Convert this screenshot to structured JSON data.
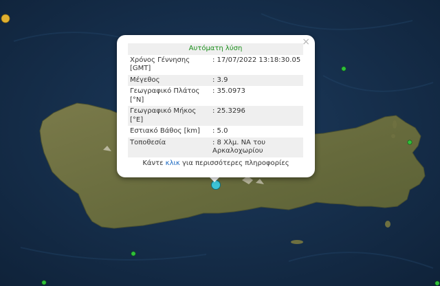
{
  "popup": {
    "close_label": "×",
    "heading": "Αυτόματη λύση",
    "rows": [
      {
        "label": "Χρόνος Γέννησης [GMT]",
        "value": ": 17/07/2022 13:18:30.05"
      },
      {
        "label": "Μέγεθος",
        "value": ": 3.9"
      },
      {
        "label": "Γεωγραφικό Πλάτος [°N]",
        "value": ": 35.0973"
      },
      {
        "label": "Γεωγραφικό Μήκος [°E]",
        "value": ": 25.3296"
      },
      {
        "label": "Εστιακό Βάθος [km]",
        "value": ": 5.0"
      },
      {
        "label": "Τοποθεσία",
        "value": ": 8 Χλμ. ΝΑ του Αρκαλοχωρίου"
      }
    ],
    "footer_before": "Κάντε",
    "footer_link": "κλικ",
    "footer_after": "για περισσότερες πληροφορίες"
  },
  "colors": {
    "sea": "#16304f",
    "land": "#6e7040",
    "selected_marker": "#3cc3d6",
    "green_marker": "#2fc03a",
    "yellow_marker": "#e0b030",
    "heading_text": "#1a8f1a",
    "link": "#1565c0"
  }
}
